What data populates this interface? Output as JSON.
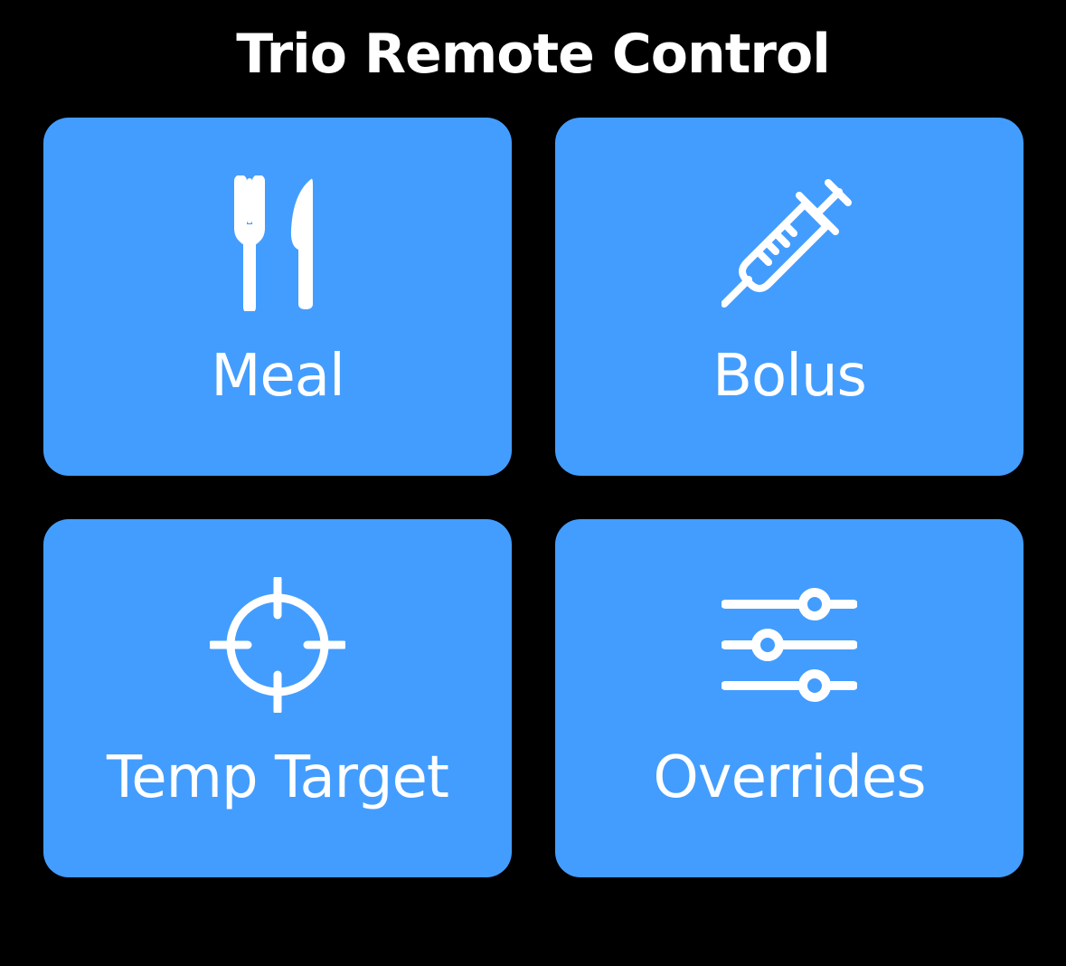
{
  "header": {
    "title": "Trio Remote Control"
  },
  "tiles": [
    {
      "label": "Meal",
      "icon": "fork-knife-icon"
    },
    {
      "label": "Bolus",
      "icon": "syringe-icon"
    },
    {
      "label": "Temp Target",
      "icon": "scope-icon"
    },
    {
      "label": "Overrides",
      "icon": "sliders-icon"
    }
  ],
  "colors": {
    "background": "#000000",
    "tile": "#439dfe",
    "text": "#ffffff"
  }
}
